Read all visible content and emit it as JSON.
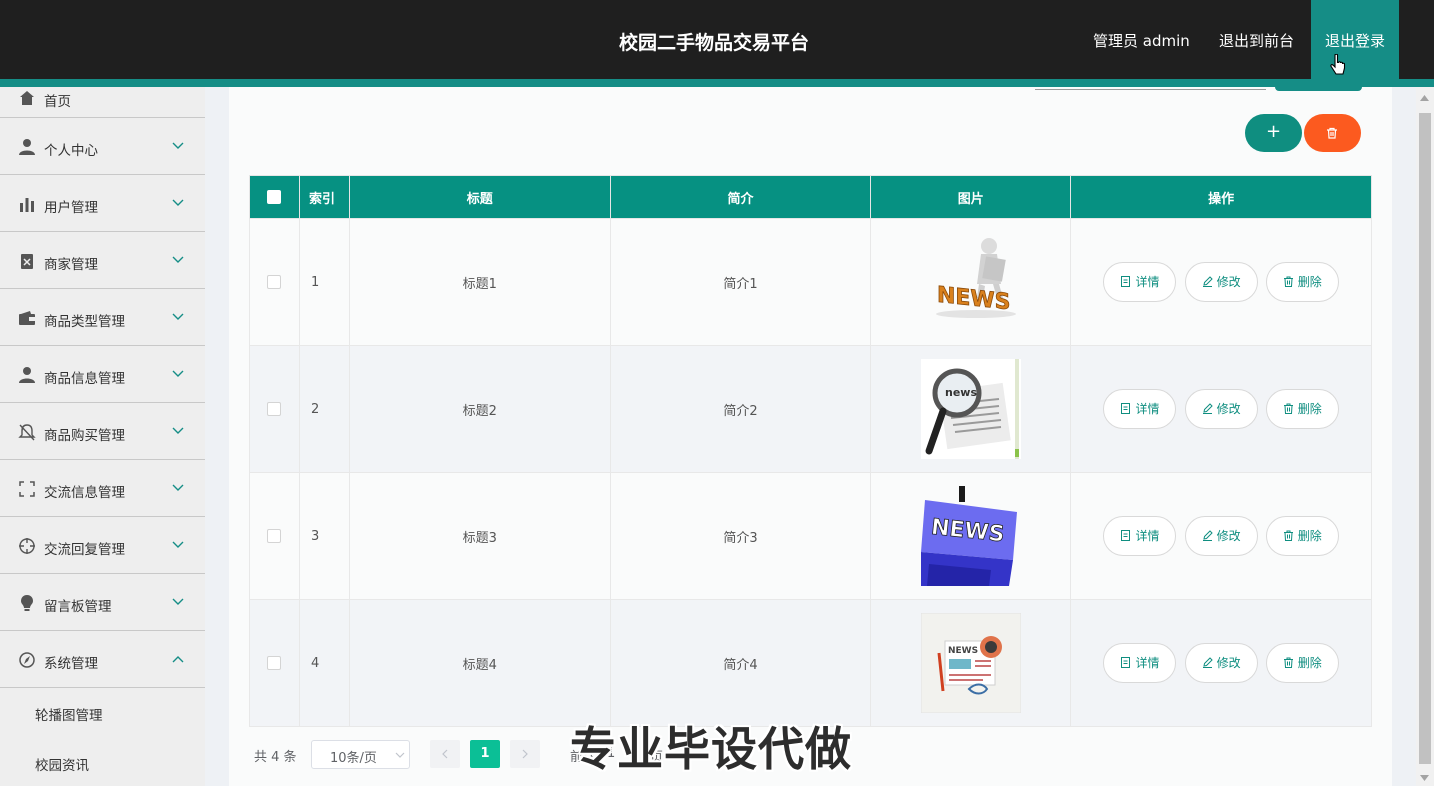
{
  "header": {
    "title": "校园二手物品交易平台",
    "admin": "管理员 admin",
    "front": "退出到前台",
    "logout": "退出登录"
  },
  "sidebar": {
    "home": "首页",
    "items": [
      {
        "label": "个人中心",
        "icon": "person-icon"
      },
      {
        "label": "用户管理",
        "icon": "bar-chart-icon"
      },
      {
        "label": "商家管理",
        "icon": "clipboard-icon"
      },
      {
        "label": "商品类型管理",
        "icon": "wallet-icon"
      },
      {
        "label": "商品信息管理",
        "icon": "person-icon"
      },
      {
        "label": "商品购买管理",
        "icon": "bell-off-icon"
      },
      {
        "label": "交流信息管理",
        "icon": "fullscreen-icon"
      },
      {
        "label": "交流回复管理",
        "icon": "crosshair-icon"
      },
      {
        "label": "留言板管理",
        "icon": "lightbulb-icon"
      },
      {
        "label": "系统管理",
        "icon": "compass-icon"
      }
    ],
    "sub_items": [
      "轮播图管理",
      "校园资讯"
    ]
  },
  "toolbar": {
    "add": "+",
    "delete_icon": "trash-icon"
  },
  "table": {
    "headers": [
      "索引",
      "标题",
      "简介",
      "图片",
      "操作"
    ],
    "rows": [
      {
        "index": "1",
        "title": "标题1",
        "intro": "简介1",
        "image": "news-figure-image"
      },
      {
        "index": "2",
        "title": "标题2",
        "intro": "简介2",
        "image": "news-magnifier-image"
      },
      {
        "index": "3",
        "title": "标题3",
        "intro": "简介3",
        "image": "news-key-image"
      },
      {
        "index": "4",
        "title": "标题4",
        "intro": "简介4",
        "image": "newspaper-image"
      }
    ],
    "actions": {
      "detail": "详情",
      "edit": "修改",
      "delete": "删除"
    }
  },
  "pagination": {
    "total": "共 4 条",
    "page_size": "10条/页",
    "current_page": "1",
    "jump_prefix": "前往",
    "jump_value": "1",
    "jump_suffix": "页"
  },
  "watermark": "专业毕设代做",
  "colors": {
    "header_bg": "#1f1f1f",
    "accent": "#158d86",
    "table_head": "#069182",
    "danger": "#fc5a1f",
    "page_active": "#0bbf96"
  }
}
